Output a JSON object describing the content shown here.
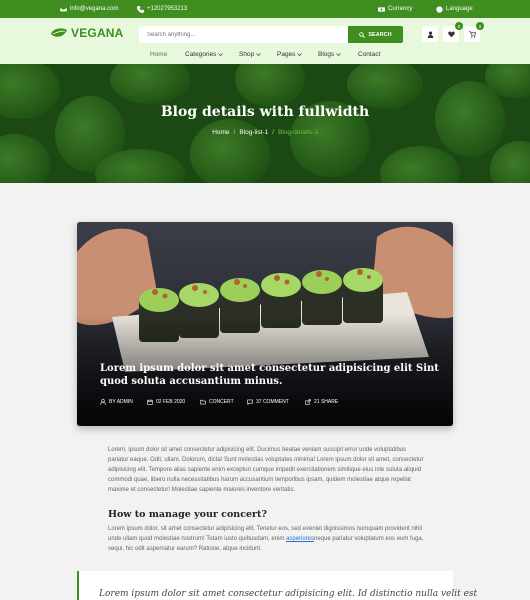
{
  "topbar": {
    "email": "info@vegana.com",
    "phone": "+12027953213",
    "currency": "Currency",
    "language": "Language"
  },
  "header": {
    "logo": "VEGANA",
    "search_placeholder": "Search anything...",
    "search_button": "SEARCH",
    "wishlist_count": "0",
    "cart_count": "0"
  },
  "nav": {
    "home": "Home",
    "categories": "Categories",
    "shop": "Shop",
    "pages": "Pages",
    "blogs": "Blogs",
    "contact": "Contact"
  },
  "hero": {
    "title": "Blog details with fullwidth",
    "breadcrumb": [
      "Home",
      "Blog-list-1",
      "Blog-details-3"
    ]
  },
  "post": {
    "title": "Lorem ipsum dolor sit amet consectetur adipisicing elit Sint quod soluta accusantium minus.",
    "author": "BY ADMIN",
    "date": "02 FEB 2020",
    "category": "CONCERT",
    "comments": "37 COMMENT",
    "shares": "21 SHARE"
  },
  "article": {
    "paragraph1": "Lorem, ipsum dolor sit amet consectetur adipisicing elit. Ducimus beatae veniam suscipit error unde voluptatibus pariatur eaque. Odit, ullam. Dolorum, dicta! Sunt molestias voluptates minima! Lorem ipsum dolor sit amet, consectetur adipisicing elit. Tempore alias sapiente enim excepturi cumque impedit exercitationem similique eius iste soluta aliquid commodi quae, libero nulla necessitatibus harum accusantium temporibus ipsam, quidem molestiae atque repellat maxime et consectetur! Molestiae sapiente maiores inventore veritatis.",
    "heading": "How to manage your concert?",
    "paragraph2_before": "Lorem ipsum dolor, sit amet consectetur adipisicing elit. Tenetur eos, sed eveniet dignissimos numquam provident nihil unde ullam quod molestiae nostrum! Totam iusto quibusdam, enim ",
    "paragraph2_link": "asperiores",
    "paragraph2_after": "neque pariatur voluptatum eos eum fuga, sequi, hic odit aspernatur earum? Ratione, atque incidunt.",
    "quote": "Lorem ipsum dolor sit amet consectetur adipisicing elit. Id distinctio nulla velit est"
  },
  "colors": {
    "brand_green": "#3f8e1f",
    "header_bg": "#e7f8dc",
    "active_crumb": "#66c23c"
  }
}
